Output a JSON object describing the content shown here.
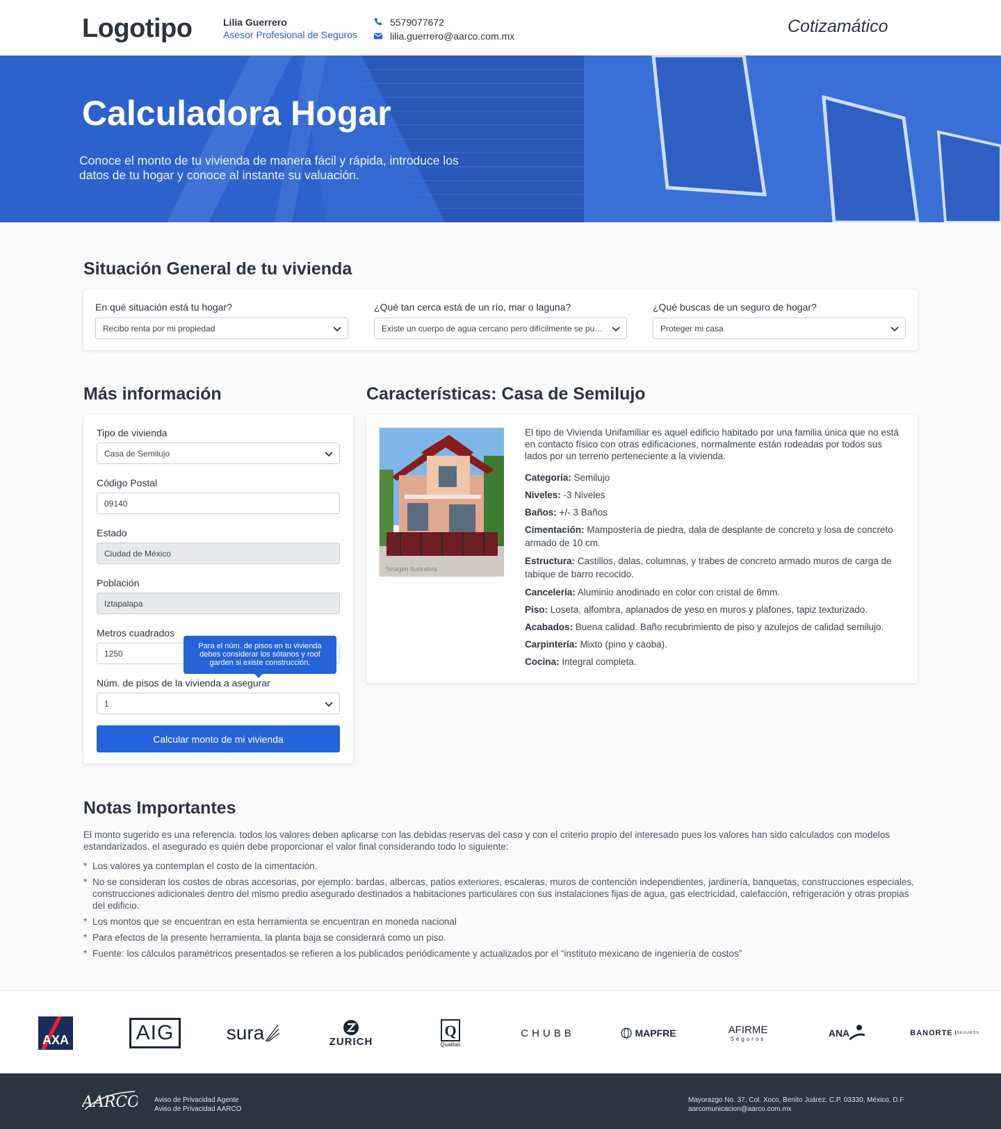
{
  "header": {
    "logo": "Logotipo",
    "agent_name": "Lilia Guerrero",
    "agent_role": "Asesor Profesional de Seguros",
    "phone": "5579077672",
    "email": "lilia.guerrero@aarco.com.mx",
    "brand": "Cotizamático"
  },
  "hero": {
    "title": "Calculadora Hogar",
    "subtitle": "Conoce el monto de tu vivienda de manera fácil y rápida, introduce los datos de tu hogar y conoce al instante su valuación."
  },
  "general": {
    "title": "Situación General de tu vivienda",
    "q1_label": "En qué situación está tu hogar?",
    "q1_value": "Recibo renta por mi propiedad",
    "q2_label": "¿Qué tan cerca está de un río, mar o laguna?",
    "q2_value": "Existe un cuerpo de agua cercano pero difícilmente se puede desbordar",
    "q3_label": "¿Qué buscas de un seguro de hogar?",
    "q3_value": "Proteger mi casa"
  },
  "more_info": {
    "title": "Más información",
    "tipo_label": "Tipo de vivienda",
    "tipo_value": "Casa de Semilujo",
    "cp_label": "Código Postal",
    "cp_value": "09140",
    "estado_label": "Estado",
    "estado_value": "Ciudad de México",
    "poblacion_label": "Población",
    "poblacion_value": "Iztapalapa",
    "metros_label": "Metros cuadrados",
    "metros_value": "1250",
    "pisos_label": "Núm. de pisos de la vivienda a asegurar",
    "pisos_value": "1",
    "tooltip": "Para el núm. de pisos en tu vivienda debes considerar los sótanos y roof garden si existe construcción.",
    "button": "Calcular monto de mi vivienda"
  },
  "features": {
    "title": "Características: Casa de Semilujo",
    "image_caption": "*Imagen Ilustrativa",
    "description": "El tipo de Vivienda Unifamiliar es aquel edificio habitado por una familia única que no está en contacto físico con otras edificaciones, normalmente están rodeadas por todos sus lados por un terreno perteneciente a la vivienda.",
    "items": [
      {
        "label": "Categoría:",
        "value": " Semilujo"
      },
      {
        "label": "Niveles:",
        "value": " -3 Niveles"
      },
      {
        "label": "Baños:",
        "value": " +/- 3 Baños"
      },
      {
        "label": "Cimentación:",
        "value": " Mampostería de piedra, dala de desplante de concreto y losa de concreto armado de 10 cm."
      },
      {
        "label": "Estructura:",
        "value": " Castillos, dalas, columnas, y trabes de concreto armado muros de carga de tabique de barro recocido."
      },
      {
        "label": "Cancelería:",
        "value": " Aluminio anodinado en color con cristal de 6mm."
      },
      {
        "label": "Piso:",
        "value": " Loseta, alfombra, aplanados de yeso en muros y plafones, tapiz texturizado."
      },
      {
        "label": "Acabados:",
        "value": " Buena calidad. Baño recubrimiento de piso y azulejos de calidad semilujo."
      },
      {
        "label": "Carpintería:",
        "value": " Mixto (pino y caoba)."
      },
      {
        "label": "Cocina:",
        "value": " Integral completa."
      }
    ]
  },
  "notes": {
    "title": "Notas Importantes",
    "paragraph": "El monto  sugerido es  una referencia.  todos los  valores deben  aplicarse con  las debidas  reservas del  caso y  con el  criterio propio  del interesado  pues los  valores han sido calculados con modelos estandarizados. el asegurado es quién debe proporcionar el valor final considerando todo lo siguiente:",
    "items": [
      "Los valores ya contemplan el costo de la cimentación.",
      "No se consideran los costos de obras accesorias, por ejemplo: bardas, albercas,  patios  exteriores, escaleras,  muros de contención independientes,  jardinería,  banquetas, construcciones especiales, construcciones adicionales dentro del mismo predio asegurado destinados a habitaciones particulares con sus instalaciones fijas de agua, gas electricidad, calefacción, refrigeración y otras propias del edificio.",
      "Los montos que se encuentran en esta herramienta se encuentran en moneda nacional",
      "Para efectos de la presente herramienta, la planta baja se considerará como un piso.",
      "Fuente: los cálculos paramétricos presentados se refieren a los publicados periódicamente y actualizados por el “instituto mexicano de ingeniería de costos”"
    ]
  },
  "partners": [
    {
      "name": "AXA",
      "icon": "axa-logo"
    },
    {
      "name": "AIG",
      "icon": "aig-logo"
    },
    {
      "name": "sura",
      "icon": "sura-logo"
    },
    {
      "name": "ZURICH",
      "icon": "zurich-logo"
    },
    {
      "name": "Qualitas",
      "icon": "qualitas-logo"
    },
    {
      "name": "CHUBB",
      "icon": "chubb-logo"
    },
    {
      "name": "MAPFRE",
      "icon": "mapfre-logo"
    },
    {
      "name": "AFIRME",
      "sub": "Seguros",
      "icon": "afirme-logo"
    },
    {
      "name": "ANA",
      "icon": "ana-logo"
    },
    {
      "name": "BANORTE",
      "sub": "SEGUROS",
      "icon": "banorte-logo"
    }
  ],
  "footer": {
    "logo": "AARCO",
    "link1": "Aviso de Privacidad Agente",
    "link2": "Aviso de Privacidad AARCO",
    "address": "Mayorazgo No. 37, Col. Xoco, Benito Juárez, C.P. 03330,  México, D.F",
    "email": "aarcomunicacion@aarco.com.mx"
  },
  "colors": {
    "accent": "#2563d8",
    "hero": "#2e63cf",
    "footer": "#2b3541"
  }
}
